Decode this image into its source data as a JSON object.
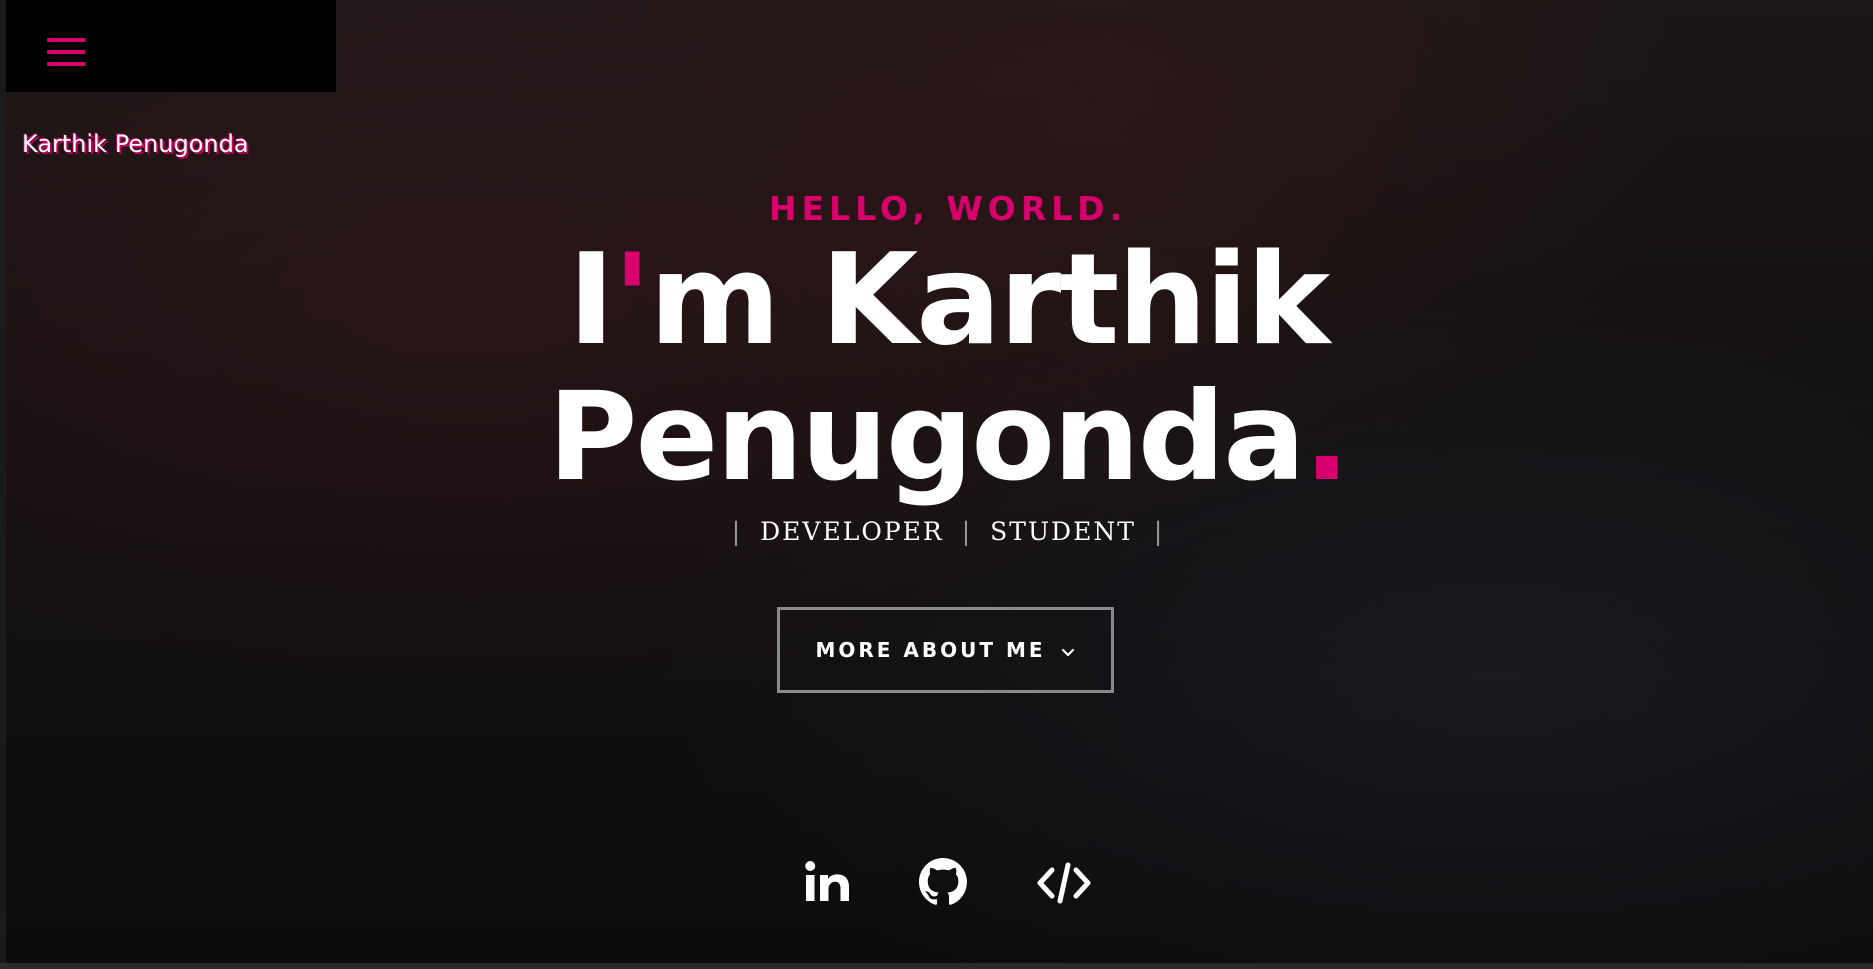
{
  "header": {
    "site_name": "Karthik Penugonda",
    "menu_icon": "hamburger-menu-icon"
  },
  "hero": {
    "kicker": "HELLO, WORLD.",
    "headline_line1_prefix": "I",
    "headline_apostrophe": "'",
    "headline_line1_rest": "m Karthik",
    "headline_line2": "Penugonda",
    "headline_period": ".",
    "roles": [
      "DEVELOPER",
      "STUDENT"
    ],
    "role_separator": "|",
    "cta_label": "MORE ABOUT ME",
    "cta_icon": "chevron-down-icon"
  },
  "social": [
    {
      "name": "linkedin",
      "icon": "linkedin-icon"
    },
    {
      "name": "github",
      "icon": "github-icon"
    },
    {
      "name": "code",
      "icon": "code-icon"
    }
  ],
  "colors": {
    "accent": "#d8006c",
    "text": "#ffffff",
    "menu_bg": "#000000"
  }
}
